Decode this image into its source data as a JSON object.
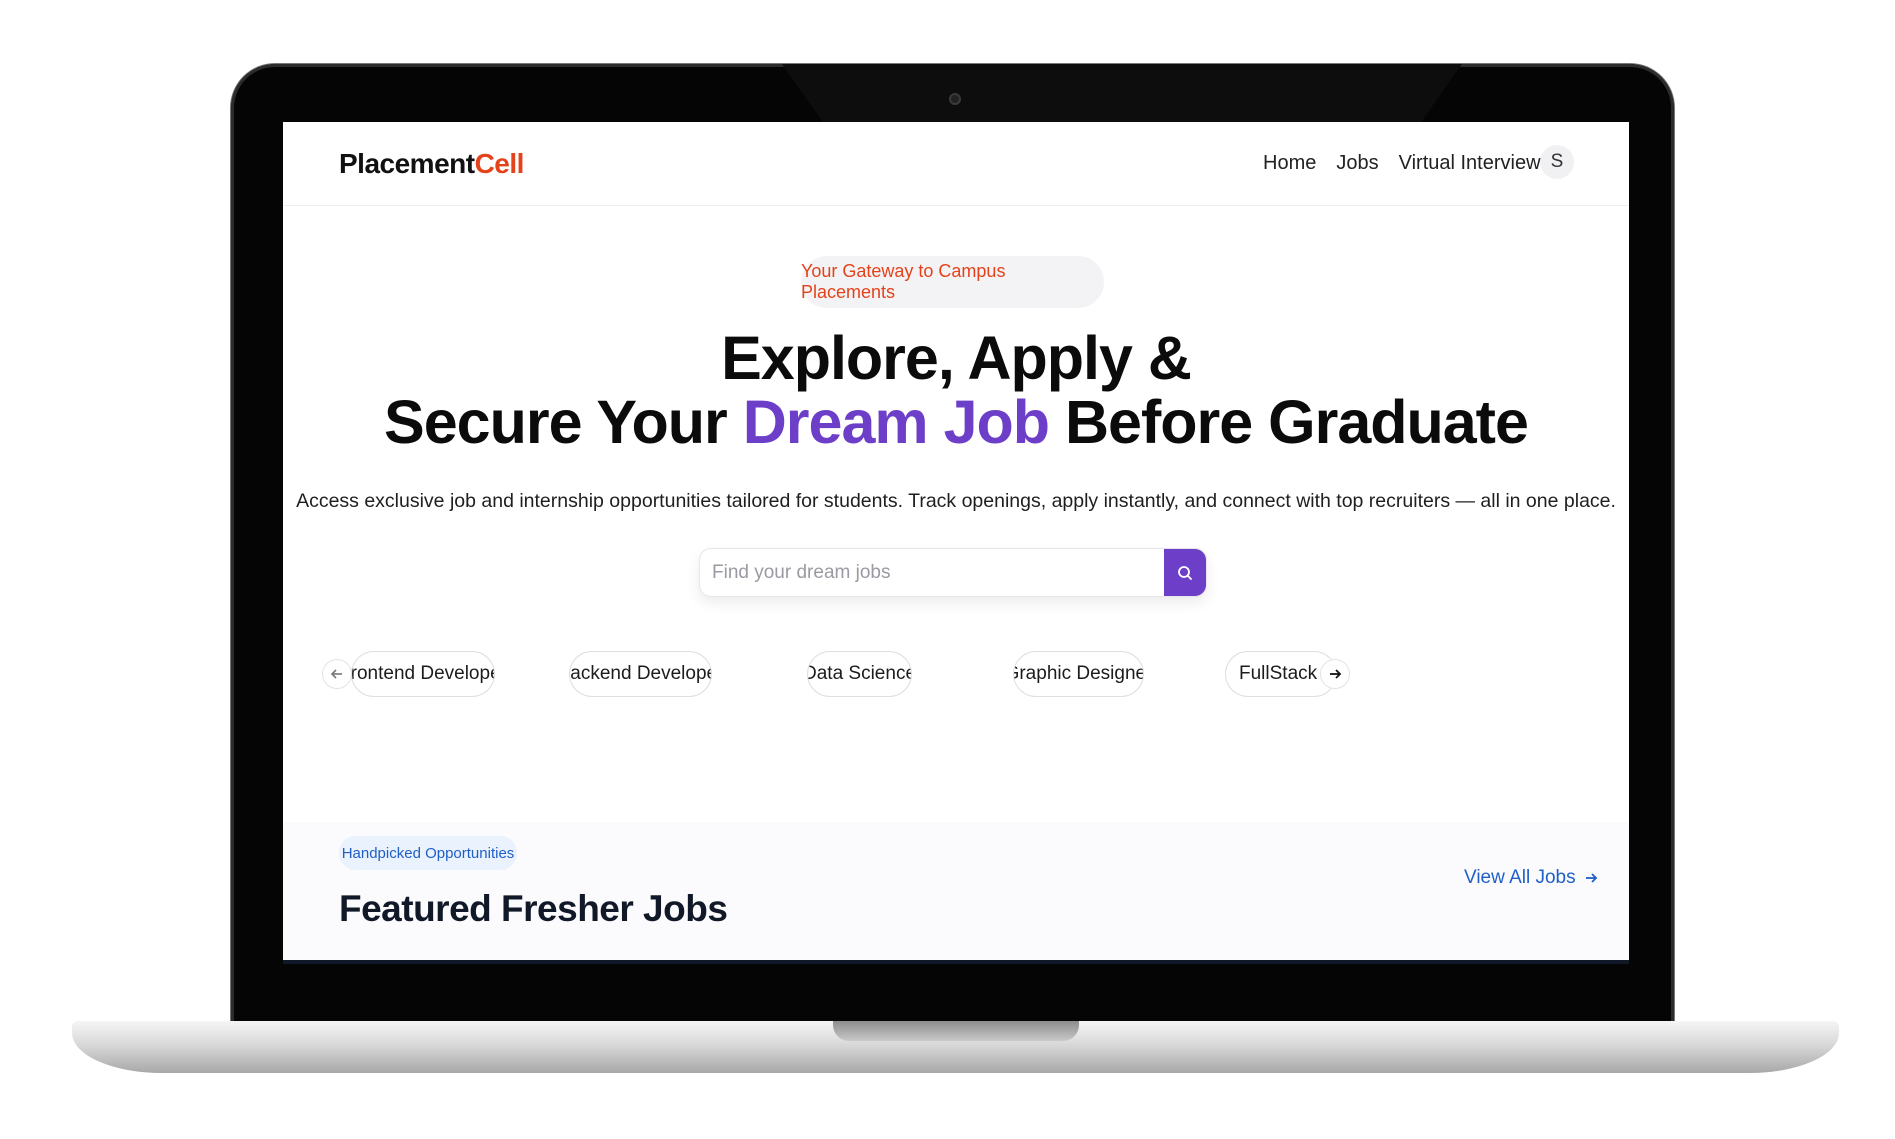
{
  "brand": {
    "name_part1": "Placement",
    "name_part2": "Cell",
    "accent_color": "#e4421b"
  },
  "nav": {
    "links": [
      "Home",
      "Jobs",
      "Virtual Interview"
    ],
    "avatar_initial": "S"
  },
  "hero": {
    "badge": "Your Gateway to Campus Placements",
    "headline_line1": "Explore, Apply &",
    "headline_line2_pre": "Secure Your ",
    "headline_line2_highlight": "Dream Job",
    "headline_line2_post": " Before Graduate",
    "highlight_color": "#6d3fc9",
    "description": "Access exclusive job and internship opportunities tailored for students. Track openings, apply instantly, and connect with top recruiters — all in one place."
  },
  "search": {
    "placeholder": "Find your dream jobs",
    "value": "",
    "button_icon": "search-icon"
  },
  "categories": {
    "items": [
      "Frontend Developer",
      "Backend Developer",
      "Data Science",
      "Graphic Designer",
      "FullStack Deve"
    ],
    "prev_icon": "arrow-left-icon",
    "next_icon": "arrow-right-icon"
  },
  "featured": {
    "badge": "Handpicked Opportunities",
    "title": "Featured Fresher Jobs",
    "view_all": "View All Jobs",
    "link_color": "#1f5fc7"
  }
}
